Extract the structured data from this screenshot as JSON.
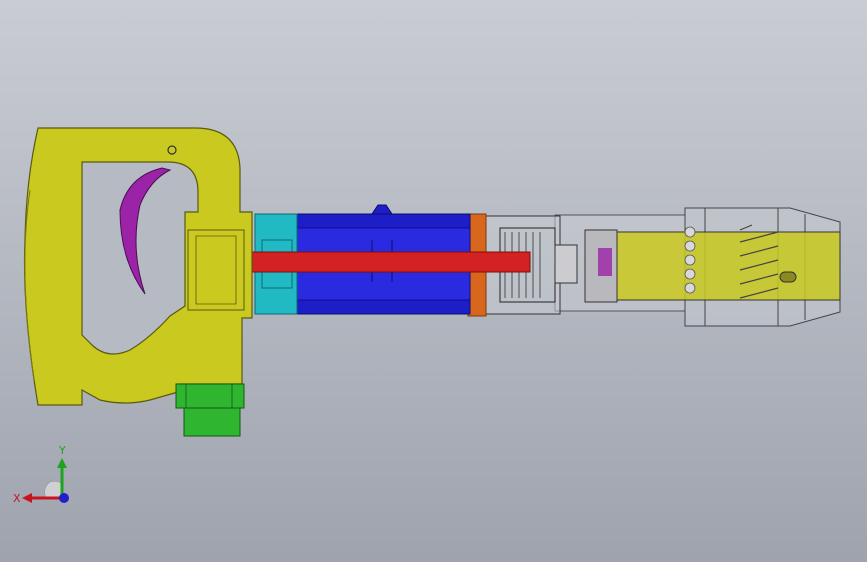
{
  "viewport": {
    "background_top": "#c9ccd3",
    "background_bottom": "#9ea3ad"
  },
  "model": {
    "parts": [
      {
        "name": "handle",
        "color": "#c9c91f"
      },
      {
        "name": "trigger",
        "color": "#9b23a8"
      },
      {
        "name": "air-inlet-nipple",
        "color": "#2fb52f"
      },
      {
        "name": "cylinder-front-ring",
        "color": "#21b9c4"
      },
      {
        "name": "cylinder",
        "color": "#1e1ec9"
      },
      {
        "name": "piston-rod",
        "color": "#d42222"
      },
      {
        "name": "valve-ring",
        "color": "#d8661c"
      },
      {
        "name": "front-head",
        "color": "#c8c8cf"
      },
      {
        "name": "chisel-retainer",
        "color": "#c9c91f"
      }
    ]
  },
  "triad": {
    "x_label": "X",
    "y_label": "Y",
    "x_color": "#c8141e",
    "y_color": "#1fa31f",
    "z_color": "#2020c8"
  }
}
